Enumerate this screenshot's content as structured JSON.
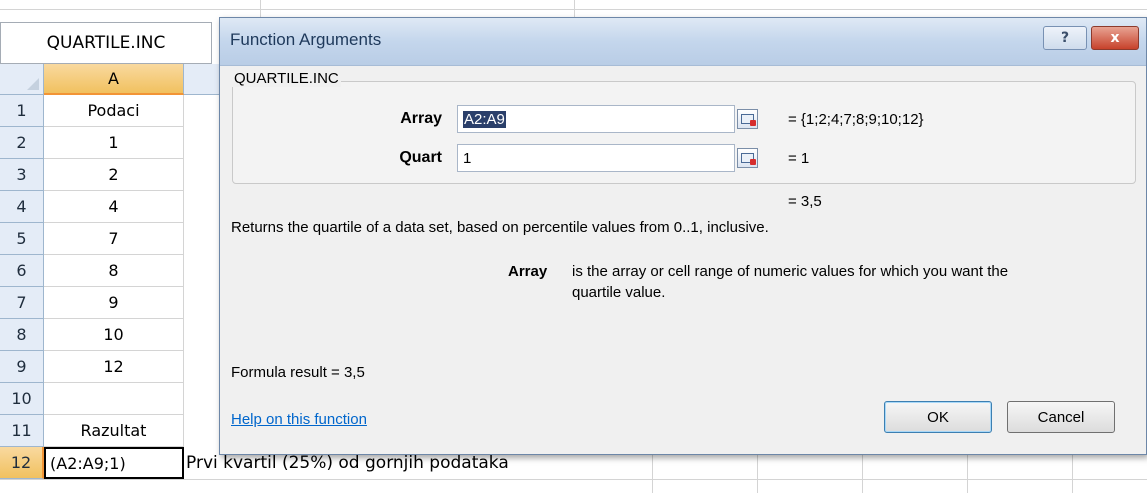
{
  "spreadsheet": {
    "name_box": "QUARTILE.INC",
    "column_header": "A",
    "rows": [
      {
        "num": "1",
        "value": "Podaci"
      },
      {
        "num": "2",
        "value": "1"
      },
      {
        "num": "3",
        "value": "2"
      },
      {
        "num": "4",
        "value": "4"
      },
      {
        "num": "5",
        "value": "7"
      },
      {
        "num": "6",
        "value": "8"
      },
      {
        "num": "7",
        "value": "9"
      },
      {
        "num": "8",
        "value": "10"
      },
      {
        "num": "9",
        "value": "12"
      },
      {
        "num": "10",
        "value": ""
      },
      {
        "num": "11",
        "value": "Razultat"
      }
    ],
    "active_row": {
      "num": "12",
      "value": "(A2:A9;1)",
      "note": "Prvi kvartil (25%) od gornjih podataka"
    }
  },
  "dialog": {
    "title": "Function Arguments",
    "help_symbol": "?",
    "close_symbol": "x",
    "group_label": "QUARTILE.INC",
    "args": {
      "array": {
        "label": "Array",
        "value": "A2:A9",
        "result": "=  {1;2;4;7;8;9;10;12}"
      },
      "quart": {
        "label": "Quart",
        "value": "1",
        "result": "=  1"
      }
    },
    "overall_result": "=  3,5",
    "description": "Returns the quartile of a data set, based on percentile values from 0..1, inclusive.",
    "arg_help_name": "Array",
    "arg_help_text_1": "is the array or cell range of numeric values for which you want the",
    "arg_help_text_2": "quartile value.",
    "formula_result": "Formula result =   3,5",
    "help_link": "Help on this function",
    "ok_label": "OK",
    "cancel_label": "Cancel"
  }
}
